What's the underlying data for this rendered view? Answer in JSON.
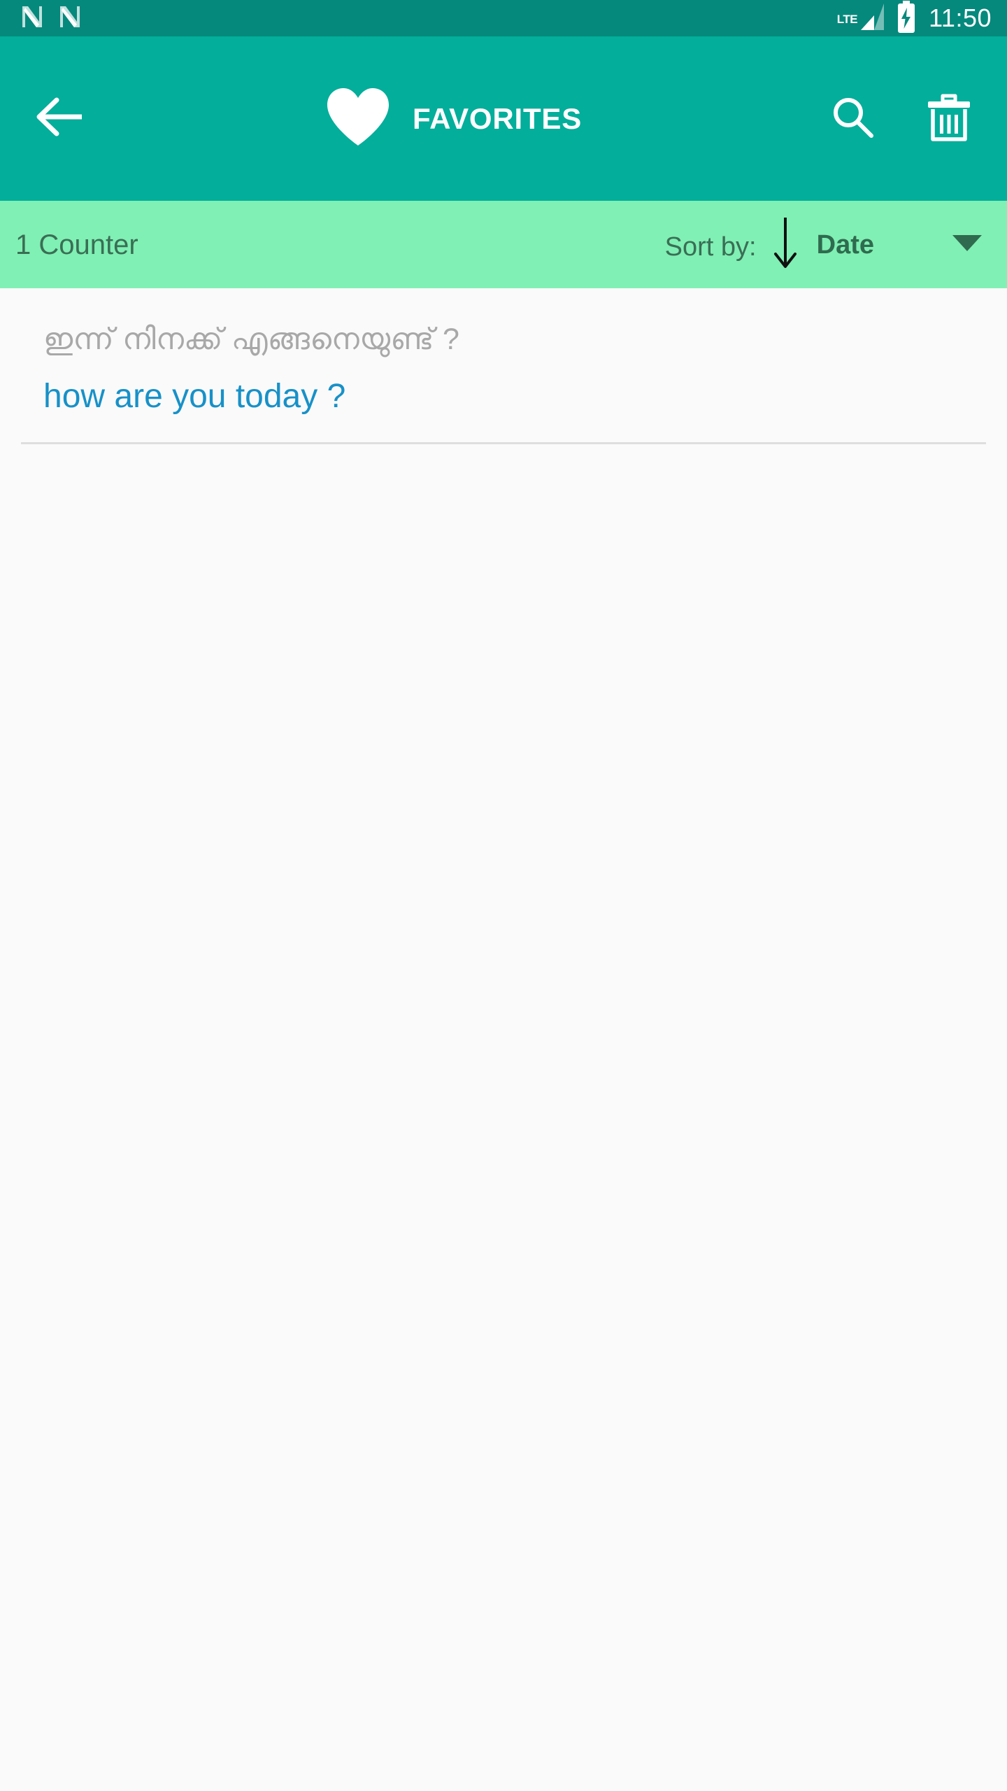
{
  "status_bar": {
    "notification_icons": [
      "notification-n-icon",
      "notification-n-icon"
    ],
    "network_label": "LTE",
    "signal_icon": "signal-bars-icon",
    "battery_icon": "battery-charging-icon",
    "time": "11:50",
    "background_color": "#05897C",
    "foreground_color": "#FFFFFF"
  },
  "app_bar": {
    "back_icon": "back-arrow-icon",
    "title_icon": "heart-icon",
    "title": "FAVORITES",
    "search_icon": "search-icon",
    "delete_icon": "trash-icon",
    "background_color": "#03AE9B",
    "foreground_color": "#FFFFFF"
  },
  "sort_bar": {
    "counter_label": "1 Counter",
    "sort_by_label": "Sort by:",
    "direction_icon": "arrow-down-icon",
    "sort_value": "Date",
    "dropdown_icon": "caret-down-icon",
    "background_color": "#80F0B4",
    "text_color": "#3A6E55"
  },
  "list": {
    "items": [
      {
        "source_text": "ഇന്ന് നിനക്ക് എങ്ങനെയുണ്ട് ?",
        "translation_text": "how are you today ?",
        "source_color": "#A8A8A8",
        "translation_color": "#1791C8"
      }
    ]
  },
  "colors": {
    "page_background": "#FAFAFA",
    "divider": "#DEDEDE"
  }
}
